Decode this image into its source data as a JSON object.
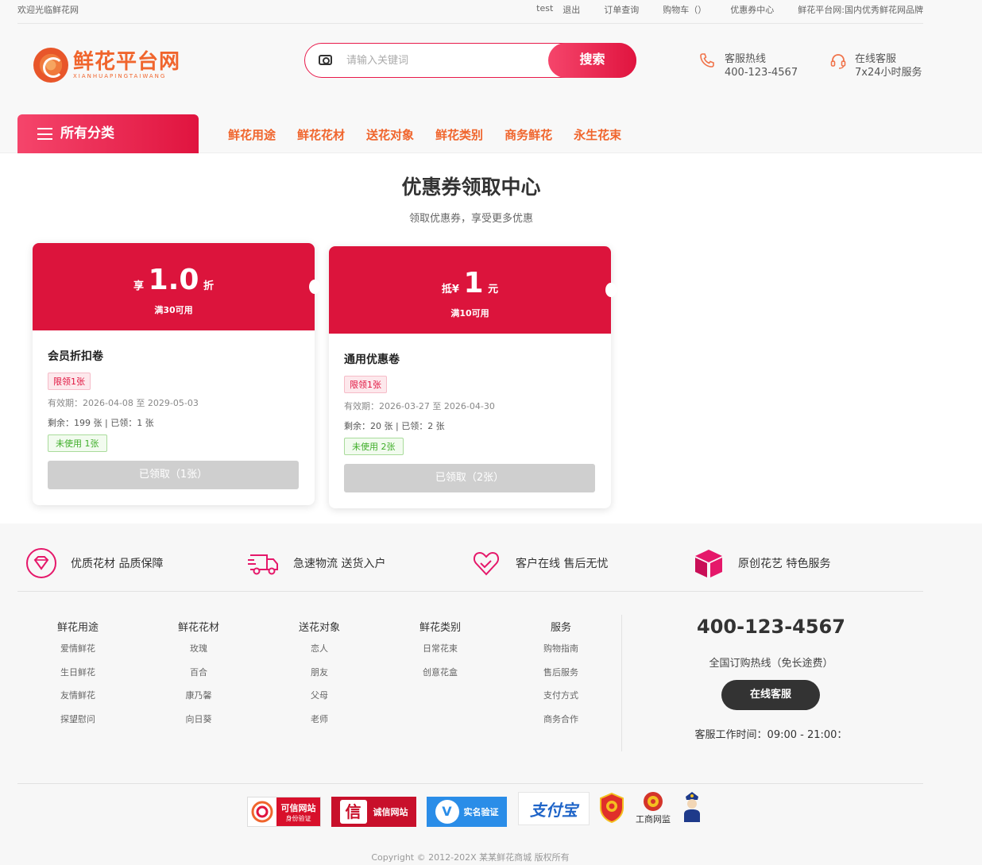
{
  "topbar": {
    "welcome": "欢迎光临鲜花网",
    "user": "test",
    "logout": "退出",
    "orders": "订单查询",
    "cart": "购物车（）",
    "coupons": "优惠券中心",
    "slogan": "鲜花平台网:国内优秀鲜花网品牌"
  },
  "logo": {
    "cn": "鲜花平台网",
    "en": "XIANHUAPINGTAIWANG"
  },
  "search": {
    "placeholder": "请输入关键词",
    "button": "搜索"
  },
  "contact": {
    "hotline_label": "客服热线",
    "hotline_number": "400-123-4567",
    "online_label": "在线客服",
    "online_hours": "7x24小时服务"
  },
  "nav": {
    "all_categories": "所有分类",
    "links": [
      "鲜花用途",
      "鲜花花材",
      "送花对象",
      "鲜花类别",
      "商务鲜花",
      "永生花束"
    ]
  },
  "page": {
    "title": "优惠券领取中心",
    "subtitle": "领取优惠券，享受更多优惠"
  },
  "coupons": [
    {
      "prefix": "享",
      "amount": "1.0",
      "suffix": "折",
      "condition": "满30可用",
      "name": "会员折扣卷",
      "limit": "限领1张",
      "validity": "有效期：2026-04-08 至 2029-05-03",
      "stock": "剩余：199 张 | 已领：1 张",
      "status": "未使用 1张",
      "button": "已领取（1张）"
    },
    {
      "prefix": "抵¥",
      "amount": "1",
      "suffix": "元",
      "condition": "满10可用",
      "name": "通用优惠卷",
      "limit": "限领1张",
      "validity": "有效期：2026-03-27 至 2026-04-30",
      "stock": "剩余：20 张 | 已领：2 张",
      "status": "未使用 2张",
      "button": "已领取（2张）"
    }
  ],
  "features": [
    {
      "icon": "diamond-icon",
      "text": "优质花材 品质保障"
    },
    {
      "icon": "truck-icon",
      "text": "急速物流 送货入户"
    },
    {
      "icon": "heart-hands-icon",
      "text": "客户在线 售后无忧"
    },
    {
      "icon": "gift-box-icon",
      "text": "原创花艺 特色服务"
    }
  ],
  "footer_columns": [
    {
      "title": "鲜花用途",
      "items": [
        "爱情鲜花",
        "生日鲜花",
        "友情鲜花",
        "探望慰问"
      ]
    },
    {
      "title": "鲜花花材",
      "items": [
        "玫瑰",
        "百合",
        "康乃馨",
        "向日葵"
      ]
    },
    {
      "title": "送花对象",
      "items": [
        "恋人",
        "朋友",
        "父母",
        "老师"
      ]
    },
    {
      "title": "鲜花类别",
      "items": [
        "日常花束",
        "创意花盒"
      ]
    },
    {
      "title": "服务",
      "items": [
        "购物指南",
        "售后服务",
        "支付方式",
        "商务合作"
      ]
    }
  ],
  "footer_contact": {
    "phone": "400-123-4567",
    "subtitle": "全国订购热线（免长途费）",
    "button": "在线客服",
    "hours": "客服工作时间：09:00 - 21:00："
  },
  "badges": {
    "trusted": "可信网站",
    "trusted_sub": "身份验证",
    "integrity": "诚信网站",
    "realname": "实名验证",
    "alipay": "支付宝",
    "icbc": "工商网监"
  },
  "copyright": "Copyright © 2012-202X 某某鲜花商城 版权所有",
  "colors": {
    "brand": "#e0143f",
    "accent": "#f0652d",
    "coupon_bg": "#dc143c"
  }
}
